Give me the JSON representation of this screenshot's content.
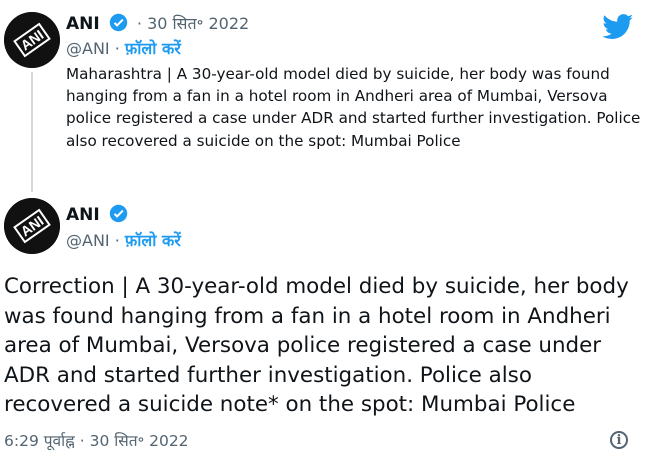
{
  "quoted_tweet": {
    "author_name": "ANI",
    "date": "· 30 सित॰ 2022",
    "handle": "@ANI",
    "separator": "·",
    "follow_label": "फ़ॉलो करें",
    "text": "Maharashtra | A 30-year-old model died by suicide, her body was found hanging from a fan in a hotel room in Andheri area of Mumbai, Versova police registered a case under ADR and started further investigation. Police also recovered a suicide on the spot: Mumbai Police"
  },
  "main_tweet": {
    "author_name": "ANI",
    "handle": "@ANI",
    "separator": "·",
    "follow_label": "फ़ॉलो करें",
    "text": "Correction | A 30-year-old model died by suicide, her body was found hanging from a fan in a hotel room in Andheri area of Mumbai, Versova police registered a case under ADR and started further investigation. Police also recovered a suicide note* on the spot: Mumbai Police",
    "timestamp": "6:29 पूर्वाह्न · 30 सित॰ 2022"
  },
  "colors": {
    "accent": "#1d9bf0",
    "muted": "#536471",
    "thread_line": "#cfd9de"
  },
  "icons": {
    "brand": "twitter-bird-icon",
    "verified": "verified-badge-icon",
    "info": "info-icon"
  }
}
